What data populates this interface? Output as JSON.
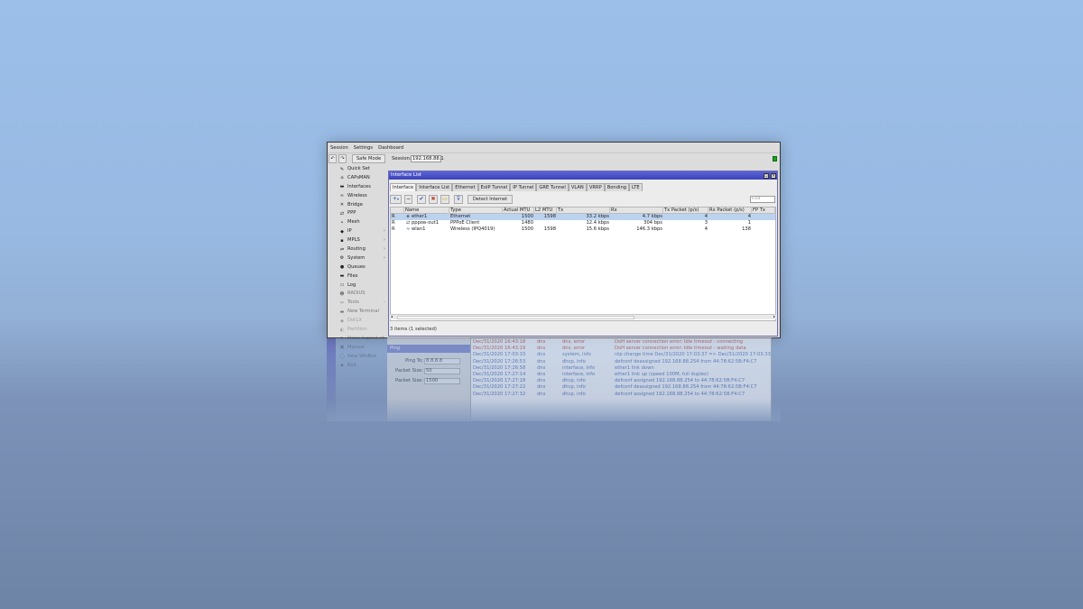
{
  "menu": [
    "Session",
    "Settings",
    "Dashboard"
  ],
  "toolbar": {
    "undo_icon": "undo-icon",
    "redo_icon": "redo-icon",
    "safe_mode": "Safe Mode",
    "session_label": "Session:",
    "session_value": "192.168.88.1"
  },
  "sidebar": [
    {
      "label": "Quick Set",
      "icon": "✎"
    },
    {
      "label": "CAPsMAN",
      "icon": "⌂"
    },
    {
      "label": "Interfaces",
      "icon": "▬"
    },
    {
      "label": "Wireless",
      "icon": "≈"
    },
    {
      "label": "Bridge",
      "icon": "✕"
    },
    {
      "label": "PPP",
      "icon": "⇄"
    },
    {
      "label": "Mesh",
      "icon": "•"
    },
    {
      "label": "IP",
      "icon": "◆",
      "arrow": "›"
    },
    {
      "label": "MPLS",
      "icon": "▪",
      "arrow": "›"
    },
    {
      "label": "Routing",
      "icon": "⇌",
      "arrow": "›"
    },
    {
      "label": "System",
      "icon": "⚙",
      "arrow": "›"
    },
    {
      "label": "Queues",
      "icon": "●"
    },
    {
      "label": "Files",
      "icon": "▬"
    },
    {
      "label": "Log",
      "icon": "▭"
    },
    {
      "label": "RADIUS",
      "icon": "☻"
    },
    {
      "label": "Tools",
      "icon": "✂",
      "arrow": "›"
    },
    {
      "label": "New Terminal",
      "icon": "▬"
    },
    {
      "label": "Dot1X",
      "icon": "◆"
    },
    {
      "label": "Partition",
      "icon": "◐"
    },
    {
      "label": "Make Supout.rif",
      "icon": "➤"
    },
    {
      "label": "Manual",
      "icon": "▣"
    },
    {
      "label": "New WinBox",
      "icon": "◯"
    },
    {
      "label": "Exit",
      "icon": "▪"
    }
  ],
  "interface_list": {
    "title": "Interface List",
    "tabs": [
      "Interface",
      "Interface List",
      "Ethernet",
      "EoIP Tunnel",
      "IP Tunnel",
      "GRE Tunnel",
      "VLAN",
      "VRRP",
      "Bonding",
      "LTE"
    ],
    "buttons": {
      "add": "+",
      "remove": "−",
      "detect_internet": "Detect Internet",
      "find_placeholder": "Find"
    },
    "columns": [
      "",
      "Name",
      "Type",
      "Actual MTU",
      "L2 MTU",
      "Tx",
      "Rx",
      "Tx Packet (p/s)",
      "Rx Packet (p/s)",
      "FP Tx"
    ],
    "rows": [
      {
        "flag": "R",
        "name": "ether1",
        "type": "Ethernet",
        "mtu": "1500",
        "l2mtu": "1598",
        "tx": "33.2 kbps",
        "rx": "4.7 kbps",
        "txp": "4",
        "rxp": "4"
      },
      {
        "flag": "R",
        "name": "pppoe-out1",
        "type": "PPPoE Client",
        "mtu": "1480",
        "l2mtu": "",
        "tx": "12.4 kbps",
        "rx": "304 bps",
        "txp": "3",
        "rxp": "1"
      },
      {
        "flag": "R",
        "name": "wlan1",
        "type": "Wireless (IPQ4019)",
        "mtu": "1500",
        "l2mtu": "1598",
        "tx": "15.6 kbps",
        "rx": "146.3 kbps",
        "txp": "4",
        "rxp": "138"
      }
    ],
    "status": "3 items (1 selected)"
  },
  "ping_window": {
    "title": "Ping",
    "fields": [
      {
        "label": "Ping To:",
        "value": "8.8.8.8"
      },
      {
        "label": "Packet Size:",
        "value": "50"
      },
      {
        "label": "Packet Size:",
        "value": "1500"
      }
    ]
  },
  "log": [
    {
      "time": "Dec/31/2020 16:43:18",
      "topic": "dns",
      "level": "dns, error",
      "msg": "DoH server connection error: Idle timeout - connecting",
      "color": "#c0392b"
    },
    {
      "time": "Dec/31/2020 16:43:19",
      "topic": "dns",
      "level": "dns, error",
      "msg": "DoH server connection error: Idle timeout - waiting data",
      "color": "#c0392b"
    },
    {
      "time": "Dec/31/2020 17:03:33",
      "topic": "dns",
      "level": "system, info",
      "msg": "ntp change time Dec/31/2020 17:03:37 => Dec/31/2020 17:03:33",
      "color": "#3b5ea8"
    },
    {
      "time": "Dec/31/2020 17:26:53",
      "topic": "dns",
      "level": "dhcp, info",
      "msg": "defconf deassigned 192.168.88.254 from 44:78:62:5B:F4:C7",
      "color": "#3b5ea8"
    },
    {
      "time": "Dec/31/2020 17:26:58",
      "topic": "dns",
      "level": "interface, info",
      "msg": "ether1 link down",
      "color": "#3b5ea8"
    },
    {
      "time": "Dec/31/2020 17:27:14",
      "topic": "dns",
      "level": "interface, info",
      "msg": "ether1 link up (speed 100M, full duplex)",
      "color": "#3b5ea8"
    },
    {
      "time": "Dec/31/2020 17:27:18",
      "topic": "dns",
      "level": "dhcp, info",
      "msg": "defconf assigned 192.168.88.254 to 44:78:62:5B:F4:C7",
      "color": "#3b5ea8"
    },
    {
      "time": "Dec/31/2020 17:27:22",
      "topic": "dns",
      "level": "dhcp, info",
      "msg": "defconf deassigned 192.168.88.254 from 44:78:62:5B:F4:C7",
      "color": "#3b5ea8"
    },
    {
      "time": "Dec/31/2020 17:27:32",
      "topic": "dns",
      "level": "dhcp, info",
      "msg": "defconf assigned 192.168.88.254 to 44:78:62:5B:F4:C7",
      "color": "#3b5ea8"
    }
  ],
  "colors": {
    "title_bar": "#3b42b8",
    "selected_row": "#bcd3ef",
    "sidebar_stripe": "#4b4fcc",
    "status_green": "#1aa31a"
  }
}
